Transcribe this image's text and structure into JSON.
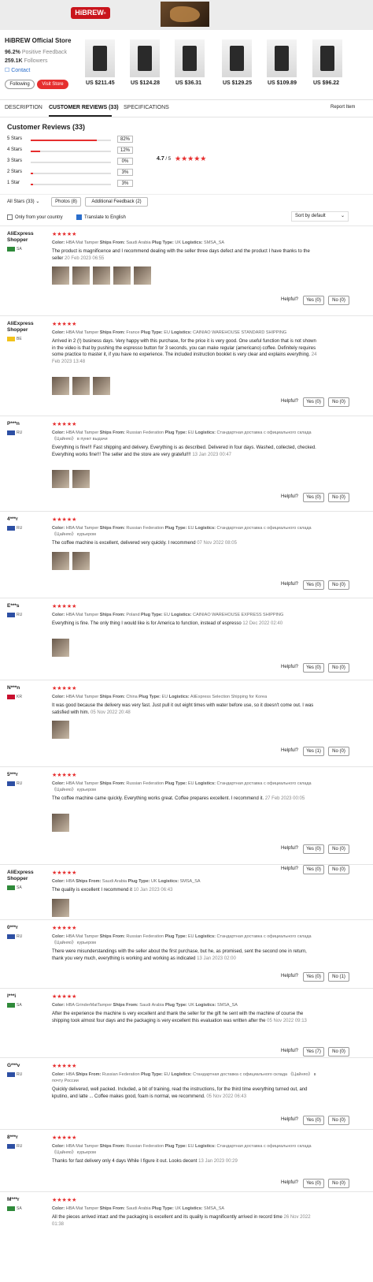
{
  "banner": {
    "logo": "HiBREW",
    "reg": "®"
  },
  "store": {
    "name": "HiBREW Official Store",
    "positive_value": "96.2%",
    "positive_label": "Positive Feedback",
    "followers_value": "259.1K",
    "followers_label": "Followers",
    "contact": "Contact",
    "follow": "Following",
    "visit": "Visit Store",
    "products": [
      {
        "price": "US $211.45"
      },
      {
        "price": "US $124.28"
      },
      {
        "price": "US $36.31"
      },
      {
        "price": "US $129.25"
      },
      {
        "price": "US $109.89"
      },
      {
        "price": "US $96.22"
      }
    ]
  },
  "tabs": {
    "description": "DESCRIPTION",
    "reviews": "CUSTOMER REVIEWS (33)",
    "specs": "SPECIFICATIONS",
    "report": "Report Item"
  },
  "ratings": {
    "title": "Customer Reviews (33)",
    "rows": [
      {
        "label": "5 Stars",
        "pct": "82%",
        "value": 82
      },
      {
        "label": "4 Stars",
        "pct": "12%",
        "value": 12
      },
      {
        "label": "3 Stars",
        "pct": "0%",
        "value": 0
      },
      {
        "label": "2 Stars",
        "pct": "3%",
        "value": 3
      },
      {
        "label": "1 Star",
        "pct": "3%",
        "value": 3
      }
    ],
    "avg": "4.7",
    "avg_of": " / 5",
    "stars": "★★★★★"
  },
  "filters": {
    "all": "All Stars (33)",
    "all_caret": "⌄",
    "photos": "Photos (8)",
    "additional": "Additional Feedback (2)",
    "only_country": "Only from your country",
    "translate": "Translate to English",
    "sort": "Sort by default",
    "sort_caret": "⌄"
  },
  "helpful_label": "Helpful?",
  "reviews": [
    {
      "name": "AliExpress Shopper",
      "country": "SA",
      "flag": "#2f8a3a",
      "stars": "★★★★★",
      "meta": [
        [
          "Color:",
          "HBA Mat Tamper"
        ],
        [
          "Ships From:",
          "Saudi Arabia"
        ],
        [
          "Plug Type:",
          "UK"
        ],
        [
          "Logistics:",
          "SMSA_SA"
        ]
      ],
      "text": "The product is magnificence and I recommend dealing with the seller three days defect and the product I have thanks to the seller",
      "date": "20 Feb 2023 06:55",
      "images": 5,
      "yes": "Yes (0)",
      "no": "No (0)"
    },
    {
      "name": "AliExpress Shopper",
      "country": "BE",
      "flag": "#f2c21b",
      "stars": "★★★★★",
      "meta": [
        [
          "Color:",
          "HBA Mat Tamper"
        ],
        [
          "Ships From:",
          "France"
        ],
        [
          "Plug Type:",
          "EU"
        ],
        [
          "Logistics:",
          "CAINIAO WAREHOUSE STANDARD SHIPPING"
        ]
      ],
      "text": "Arrived in 2 (!) business days. Very happy with this purchase, for the price it is very good. One useful function that is not shown in the video is that by pushing the espresso button for 3 seconds, you can make regular (americano) coffee. Definitely requires some practice to master it, if you have no experience. The included instruction booklet is very clear and explains everything.",
      "date": "24 Feb 2023 13:48",
      "images": 3,
      "yes": "Yes (0)",
      "no": "No (0)"
    },
    {
      "name": "P***n",
      "country": "RU",
      "flag": "#2d4fa3",
      "stars": "★★★★★",
      "meta": [
        [
          "Color:",
          "HBA Mat Tamper"
        ],
        [
          "Ships From:",
          "Russian Federation"
        ],
        [
          "Plug Type:",
          "EU"
        ],
        [
          "Logistics:",
          "Стандартная доставка с официального склада 《Цайняо》 в пункт выдачи"
        ]
      ],
      "text": "Everything is fine!!! Fast shipping and delivery. Everything is as described. Delivered in four days. Washed, collected, checked. Everything works fine!!! The seller and the store are very grateful!!!",
      "date": "13 Jan 2023 00:47",
      "images": 2,
      "yes": "Yes (0)",
      "no": "No (0)"
    },
    {
      "name": "4***r",
      "country": "RU",
      "flag": "#2d4fa3",
      "stars": "★★★★★",
      "meta": [
        [
          "Color:",
          "HBA Mat Tamper"
        ],
        [
          "Ships From:",
          "Russian Federation"
        ],
        [
          "Plug Type:",
          "EU"
        ],
        [
          "Logistics:",
          "Стандартная доставка с официального склада 《Цайняо》 курьером"
        ]
      ],
      "text": "The coffee machine is excellent, delivered very quickly. I recommend",
      "date": "07 Nov 2022 08:05",
      "images": 2,
      "yes": "Yes (0)",
      "no": "No (0)"
    },
    {
      "name": "E***s",
      "country": "RU",
      "flag": "#2d4fa3",
      "stars": "★★★★★",
      "meta": [
        [
          "Color:",
          "HBA Mat Tamper"
        ],
        [
          "Ships From:",
          "Poland"
        ],
        [
          "Plug Type:",
          "EU"
        ],
        [
          "Logistics:",
          "CAINIAO WAREHOUSE EXPRESS SHIPPING"
        ]
      ],
      "text": "Everything is fine. The only thing I would like is for America to function, instead of espresso",
      "date": "12 Dec 2022 02:40",
      "images": 1,
      "yes": "Yes (0)",
      "no": "No (0)"
    },
    {
      "name": "N***n",
      "country": "KR",
      "flag": "#c8102e",
      "stars": "★★★★★",
      "meta": [
        [
          "Color:",
          "HBA Mat Tamper"
        ],
        [
          "Ships From:",
          "China"
        ],
        [
          "Plug Type:",
          "EU"
        ],
        [
          "Logistics:",
          "AliExpress Selection Shipping for Korea"
        ]
      ],
      "text": "It was good because the delivery was very fast. Just pull it out eight times with water before use, so it doesn't come out. I was satisfied with him.",
      "date": "05 Nov 2022 20:48",
      "images": 1,
      "yes": "Yes (1)",
      "no": "No (0)"
    },
    {
      "name": "5***r",
      "country": "RU",
      "flag": "#2d4fa3",
      "stars": "★★★★★",
      "meta": [
        [
          "Color:",
          "HBA Mat Tamper"
        ],
        [
          "Ships From:",
          "Russian Federation"
        ],
        [
          "Plug Type:",
          "EU"
        ],
        [
          "Logistics:",
          "Стандартная доставка с официального склада 《Цайняо》 курьером"
        ]
      ],
      "text": "The coffee machine came quickly. Everything works great. Coffee prepares excellent. I recommend it.",
      "date": "27 Feb 2023 00:05",
      "images": 1,
      "yes": "Yes (0)",
      "no": "No (0)"
    },
    {
      "name": "AliExpress Shopper",
      "country": "SA",
      "flag": "#2f8a3a",
      "stars": "★★★★★",
      "meta": [
        [
          "Color:",
          "HBA"
        ],
        [
          "Ships From:",
          "Saudi Arabia"
        ],
        [
          "Plug Type:",
          "UK"
        ],
        [
          "Logistics:",
          "SMSA_SA"
        ]
      ],
      "text": "The quality is excellent I recommend it",
      "date": "10 Jan 2023 06:43",
      "images": 1,
      "yes": "Yes (0)",
      "no": "No (0)"
    },
    {
      "name": "0***r",
      "country": "RU",
      "flag": "#2d4fa3",
      "stars": "★★★★★",
      "meta": [
        [
          "Color:",
          "HBA Mat Tamper"
        ],
        [
          "Ships From:",
          "Russian Federation"
        ],
        [
          "Plug Type:",
          "EU"
        ],
        [
          "Logistics:",
          "Стандартная доставка с официального склада 《Цайняо》 курьером"
        ]
      ],
      "text": "There were misunderstandings with the seller about the first purchase, but he, as promised, sent the second one in return, thank you very much, everything is working and working as indicated",
      "date": "13 Jan 2023 02:00",
      "images": 0,
      "yes": "Yes (0)",
      "no": "No (1)"
    },
    {
      "name": "I***i",
      "country": "SA",
      "flag": "#2f8a3a",
      "stars": "★★★★★",
      "meta": [
        [
          "Color:",
          "HBA GrinderMatTamper"
        ],
        [
          "Ships From:",
          "Saudi Arabia"
        ],
        [
          "Plug Type:",
          "UK"
        ],
        [
          "Logistics:",
          "SMSA_SA"
        ]
      ],
      "text": "After the experience the machine is very excellent and thank the seller for the gift he sent with the machine of course the shipping took almost four days and the packaging is very excellent this evaluation was written after the",
      "date": "05 Nov 2022 09:13",
      "images": 0,
      "yes": "Yes (7)",
      "no": "No (0)"
    },
    {
      "name": "G***v",
      "country": "RU",
      "flag": "#2d4fa3",
      "stars": "★★★★★",
      "meta": [
        [
          "Color:",
          "HBA"
        ],
        [
          "Ships From:",
          "Russian Federation"
        ],
        [
          "Plug Type:",
          "EU"
        ],
        [
          "Logistics:",
          "Стандартная доставка с официального склада 《Цайняо》 в почту России"
        ]
      ],
      "text": "Quickly delivered, well packed. Included, a bit of training, read the instructions, for the third time everything turned out, and kputino, and latte ... Coffee makes good, foam is normal, we recommend.",
      "date": "05 Nov 2022 06:43",
      "images": 0,
      "yes": "Yes (0)",
      "no": "No (0)"
    },
    {
      "name": "8***r",
      "country": "RU",
      "flag": "#2d4fa3",
      "stars": "★★★★★",
      "meta": [
        [
          "Color:",
          "HBA Mat Tamper"
        ],
        [
          "Ships From:",
          "Russian Federation"
        ],
        [
          "Plug Type:",
          "EU"
        ],
        [
          "Logistics:",
          "Стандартная доставка с официального склада 《Цайняо》 курьером"
        ]
      ],
      "text": "Thanks for fast delivery only 4 days While I figure it out. Looks decent",
      "date": "13 Jan 2023 00:29",
      "images": 0,
      "yes": "Yes (0)",
      "no": "No (0)"
    },
    {
      "name": "M***r",
      "country": "SA",
      "flag": "#2f8a3a",
      "stars": "★★★★★",
      "meta": [
        [
          "Color:",
          "HBA Mat Tamper"
        ],
        [
          "Ships From:",
          "Saudi Arabia"
        ],
        [
          "Plug Type:",
          "UK"
        ],
        [
          "Logistics:",
          "SMSA_SA"
        ]
      ],
      "text": "All the pieces arrived intact and the packaging is excellent and its quality is magnificently arrived in record time",
      "date": "26 Nov 2022 01:38",
      "images": 0,
      "yes": "",
      "no": ""
    }
  ]
}
